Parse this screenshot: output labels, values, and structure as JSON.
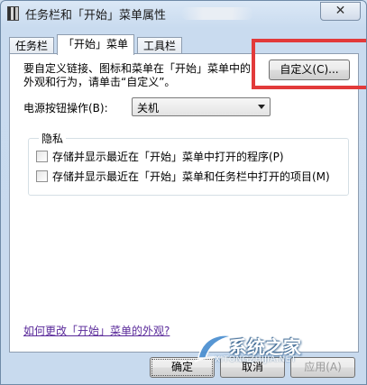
{
  "window": {
    "title": "任务栏和「开始」菜单属性",
    "close_symbol": "✕"
  },
  "tabs": [
    {
      "label": "任务栏",
      "active": false
    },
    {
      "label": "「开始」菜单",
      "active": true
    },
    {
      "label": "工具栏",
      "active": false
    }
  ],
  "start_menu": {
    "description": "要自定义链接、图标和菜单在「开始」菜单中的外观和行为，请单击“自定义”。",
    "customize_button": "自定义(C)...",
    "power_label": "电源按钮操作(B):",
    "power_value": "关机",
    "privacy": {
      "title": "隐私",
      "options": [
        {
          "label": "存储并显示最近在「开始」菜单中打开的程序(P)",
          "checked": false
        },
        {
          "label": "存储并显示最近在「开始」菜单和任务栏中打开的项目(M)",
          "checked": false
        }
      ]
    },
    "help_link": "如何更改「开始」菜单的外观?"
  },
  "footer": {
    "ok": "确定",
    "cancel": "取消",
    "apply": "应用(A)"
  },
  "watermark": {
    "title": "系统之家",
    "url": "XITONGZHIJIA.NET"
  },
  "colors": {
    "highlight_box": "#e23a3a",
    "link": "#5a2a9a",
    "window_frame": "#c8daee"
  }
}
